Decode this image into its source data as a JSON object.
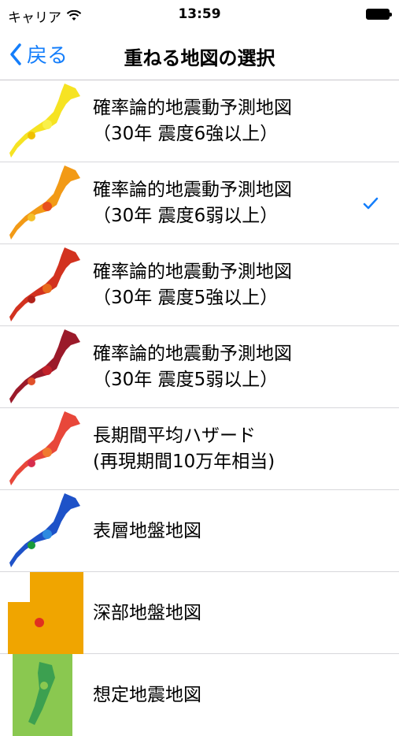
{
  "status_bar": {
    "carrier": "キャリア",
    "time": "13:59"
  },
  "nav": {
    "back_label": "戻る",
    "title": "重ねる地図の選択"
  },
  "accent_color": "#147efb",
  "items": [
    {
      "line1": "確率論的地震動予測地図",
      "line2": "（30年 震度6強以上）",
      "selected": false
    },
    {
      "line1": "確率論的地震動予測地図",
      "line2": "（30年 震度6弱以上）",
      "selected": true
    },
    {
      "line1": "確率論的地震動予測地図",
      "line2": "（30年 震度5強以上）",
      "selected": false
    },
    {
      "line1": "確率論的地震動予測地図",
      "line2": "（30年 震度5弱以上）",
      "selected": false
    },
    {
      "line1": "長期間平均ハザード",
      "line2": "(再現期間10万年相当)",
      "selected": false
    },
    {
      "line1": "表層地盤地図",
      "selected": false
    },
    {
      "line1": "深部地盤地図",
      "selected": false
    },
    {
      "line1": "想定地震地図",
      "selected": false
    }
  ],
  "thumb_colors": [
    [
      "#f6e323",
      "#f9f04a",
      "#f0c000"
    ],
    [
      "#f29a16",
      "#e8501e",
      "#f5c02a"
    ],
    [
      "#d2321f",
      "#e86a1c",
      "#b0221a"
    ],
    [
      "#9b1a2a",
      "#c2222a",
      "#e0502a"
    ],
    [
      "#e8473a",
      "#f07a30",
      "#d72d4d"
    ],
    [
      "#1e52c8",
      "#2d8ae0",
      "#1a9a3a"
    ],
    [
      "#f0a500",
      "#2060d0",
      "#e03020"
    ],
    [
      "#3ca050",
      "#8ac850",
      "#c0c0c0"
    ]
  ]
}
